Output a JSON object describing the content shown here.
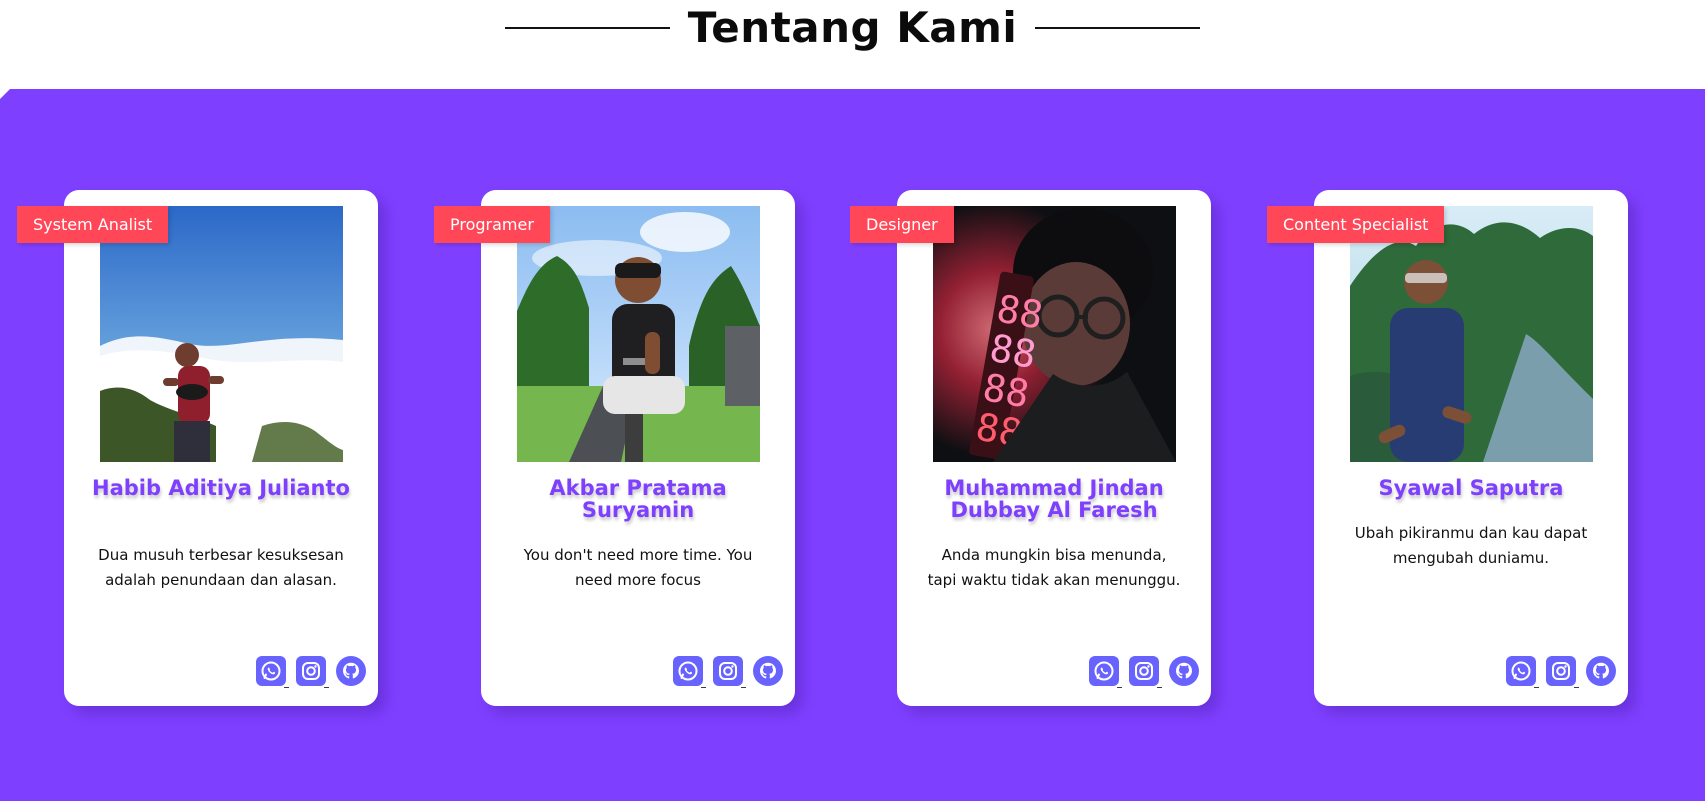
{
  "section": {
    "title": "Tentang Kami"
  },
  "colors": {
    "purple": "#7F3FFF",
    "tag": "#FF4758",
    "name": "#7F3FFF",
    "icon": "#6863FF"
  },
  "team": [
    {
      "role": "System Analist",
      "name": "Habib Aditiya Julianto",
      "quote": "Dua musuh terbesar kesuksesan adalah penundaan dan alasan.",
      "photo_icon": "mountain-photo",
      "social_icons": [
        "whatsapp-icon",
        "instagram-icon",
        "github-icon"
      ]
    },
    {
      "role": "Programer",
      "name": "Akbar Pratama Suryamin",
      "quote": "You don't need more time. You need more focus",
      "photo_icon": "outdoor-portrait-photo",
      "social_icons": [
        "whatsapp-icon",
        "instagram-icon",
        "github-icon"
      ]
    },
    {
      "role": "Designer",
      "name": "Muhammad Jindan Dubbay Al Faresh",
      "quote": "Anda mungkin bisa menunda, tapi waktu tidak akan menunggu.",
      "photo_icon": "neon-clock-photo",
      "social_icons": [
        "whatsapp-icon",
        "instagram-icon",
        "github-icon"
      ]
    },
    {
      "role": "Content Specialist",
      "name": "Syawal Saputra",
      "quote": "Ubah pikiranmu dan kau dapat mengubah duniamu.",
      "photo_icon": "forest-road-photo",
      "social_icons": [
        "whatsapp-icon",
        "instagram-icon",
        "github-icon"
      ]
    }
  ]
}
